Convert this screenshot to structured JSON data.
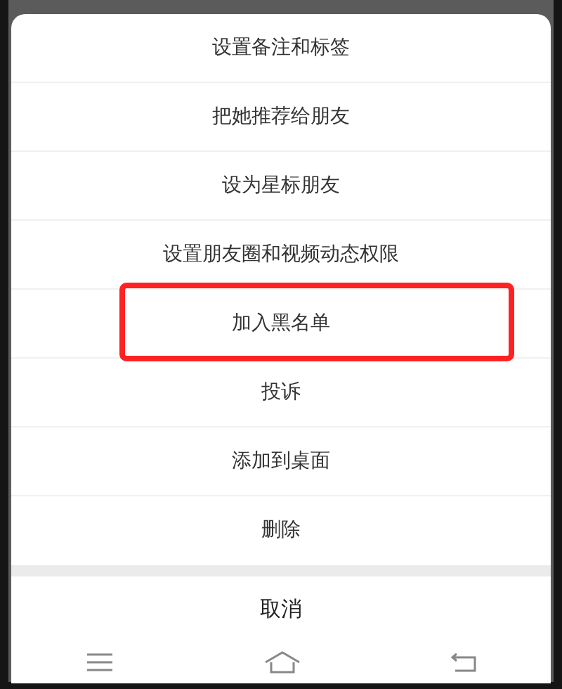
{
  "menu": {
    "items": [
      {
        "label": "设置备注和标签",
        "highlighted": false
      },
      {
        "label": "把她推荐给朋友",
        "highlighted": false
      },
      {
        "label": "设为星标朋友",
        "highlighted": false
      },
      {
        "label": "设置朋友圈和视频动态权限",
        "highlighted": false
      },
      {
        "label": "加入黑名单",
        "highlighted": true
      },
      {
        "label": "投诉",
        "highlighted": false
      },
      {
        "label": "添加到桌面",
        "highlighted": false
      },
      {
        "label": "删除",
        "highlighted": false
      }
    ],
    "cancel": "取消"
  }
}
